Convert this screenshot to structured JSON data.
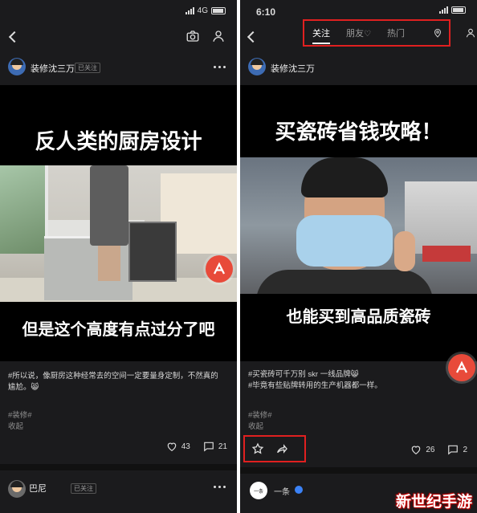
{
  "left": {
    "status": {
      "carrier": "4G"
    },
    "post": {
      "author": "装修沈三万",
      "follow_label": "已关注",
      "media_title": "反人类的厨房设计",
      "media_subtitle": "但是这个高度有点过分了吧",
      "caption": "#所以说，像厨房这种经常去的空间一定要量身定制，不然真的尴尬。😸",
      "tag": "#装修#",
      "collapse": "收起",
      "likes": "43",
      "comments": "21"
    },
    "next_post": {
      "author_partial": "巴尼",
      "follow_label": "已关注"
    }
  },
  "right": {
    "status": {
      "time": "6:10"
    },
    "tabs": [
      {
        "label": "关注"
      },
      {
        "label": "朋友"
      },
      {
        "label": "热门"
      }
    ],
    "post": {
      "author": "装修沈三万",
      "media_title": "买瓷砖省钱攻略！",
      "media_subtitle": "也能买到高品质瓷砖",
      "caption_line1": "#买瓷砖可千万别 skr 一线品牌😸",
      "caption_line2": "#毕竟有些贴牌转用的生产机器都一样。",
      "tag": "#装修#",
      "collapse": "收起",
      "likes": "26",
      "comments": "2"
    },
    "next_post": {
      "author": "一条",
      "avatar_text": "一条"
    }
  },
  "watermark": "新世纪手游",
  "colors": {
    "background": "#1b1b1d",
    "highlight_box": "#e02020",
    "fab": "#e84a3a"
  },
  "icons": [
    "back-icon",
    "camera-icon",
    "profile-icon",
    "location-icon",
    "more-icon",
    "heart-icon",
    "comment-icon",
    "star-icon",
    "share-icon",
    "app-logo-icon",
    "verified-icon"
  ]
}
